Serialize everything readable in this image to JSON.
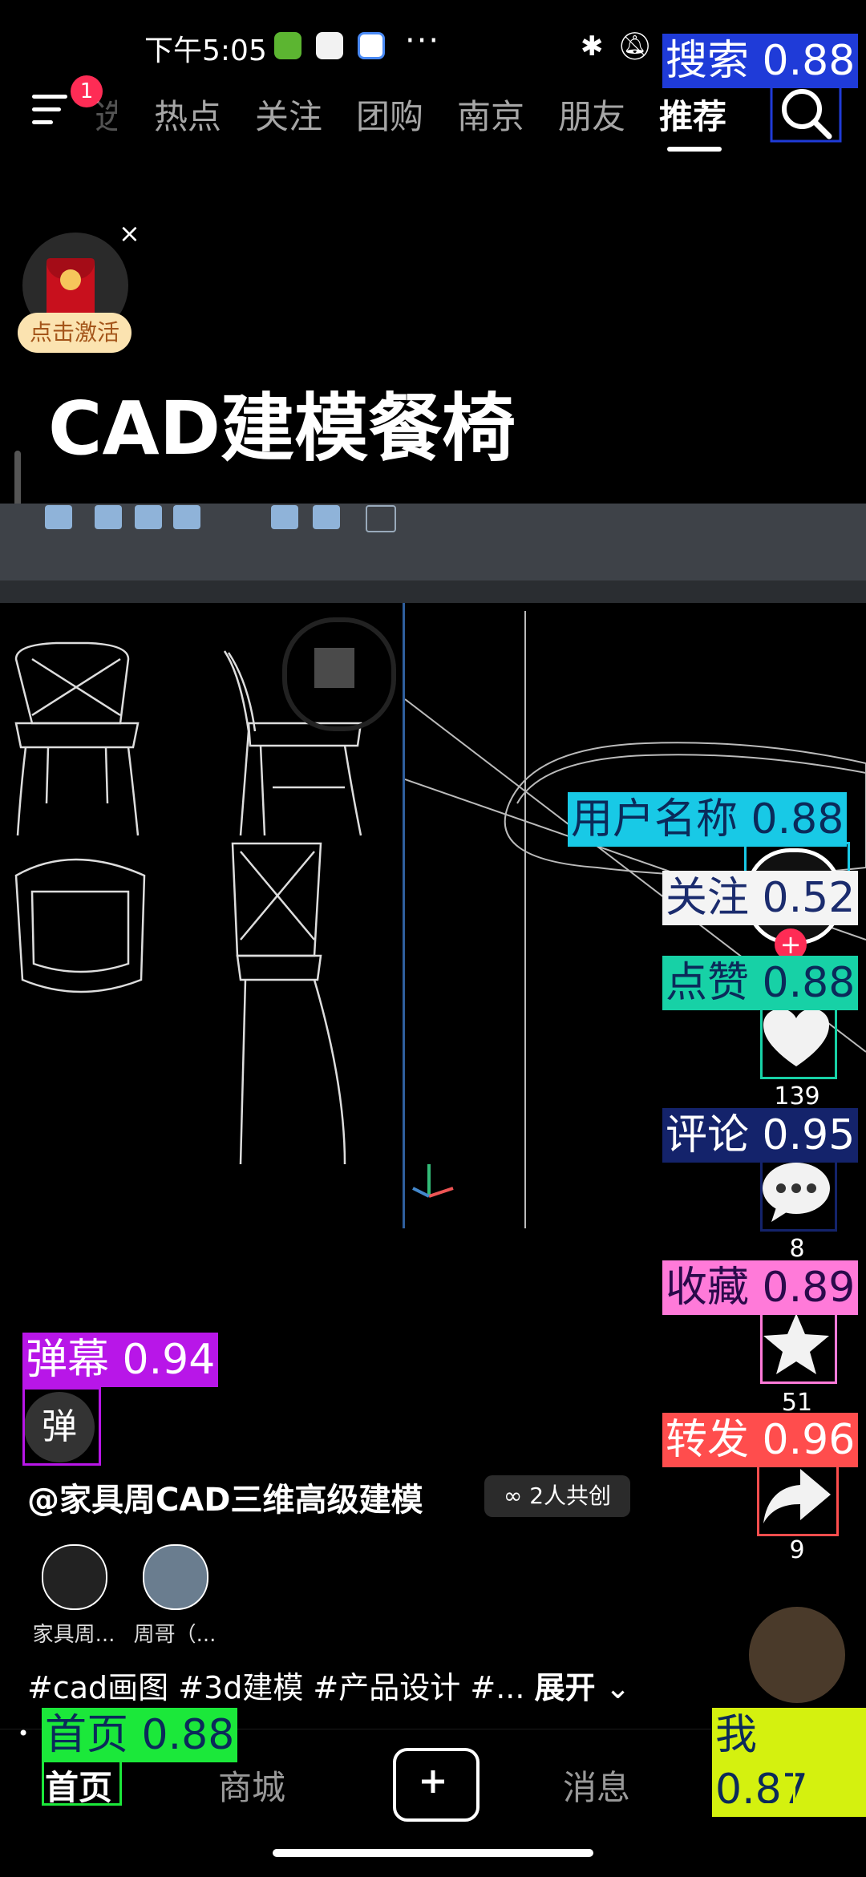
{
  "status_bar": {
    "time": "下午5:05",
    "more": "···"
  },
  "top_nav": {
    "notification_count": "1",
    "tabs": [
      "热点",
      "关注",
      "团购",
      "南京",
      "朋友",
      "推荐"
    ],
    "active_tab": "推荐"
  },
  "red_packet": {
    "label": "点击激活",
    "close": "×"
  },
  "video": {
    "title": "CAD建模餐椅"
  },
  "actions": {
    "like_count": "139",
    "comment_count": "8",
    "favorite_count": "51",
    "share_count": "9"
  },
  "danmaku": {
    "label": "弹"
  },
  "author": {
    "name": "@家具周CAD三维高级建模",
    "cocreate": "2人共创",
    "cocreators": [
      "家具周...",
      "周哥（..."
    ]
  },
  "tags": {
    "text": "#cad画图 #3d建模 #产品设计 #...",
    "expand": "展开"
  },
  "bottom_nav": {
    "items": [
      "首页",
      "商城",
      "消息",
      "我"
    ],
    "active": "首页"
  },
  "annotations": {
    "search": "搜索 0.88",
    "username": "用户名称 0.88",
    "follow": "关注 0.52",
    "like": "点赞 0.88",
    "comment": "评论 0.95",
    "favorite": "收藏 0.89",
    "share": "转发 0.96",
    "danmaku": "弹幕 0.94",
    "home": "首页 0.88",
    "me": "我 0.87"
  },
  "colors": {
    "accent": "#fe2c55",
    "toolbar": "#3e4248"
  }
}
